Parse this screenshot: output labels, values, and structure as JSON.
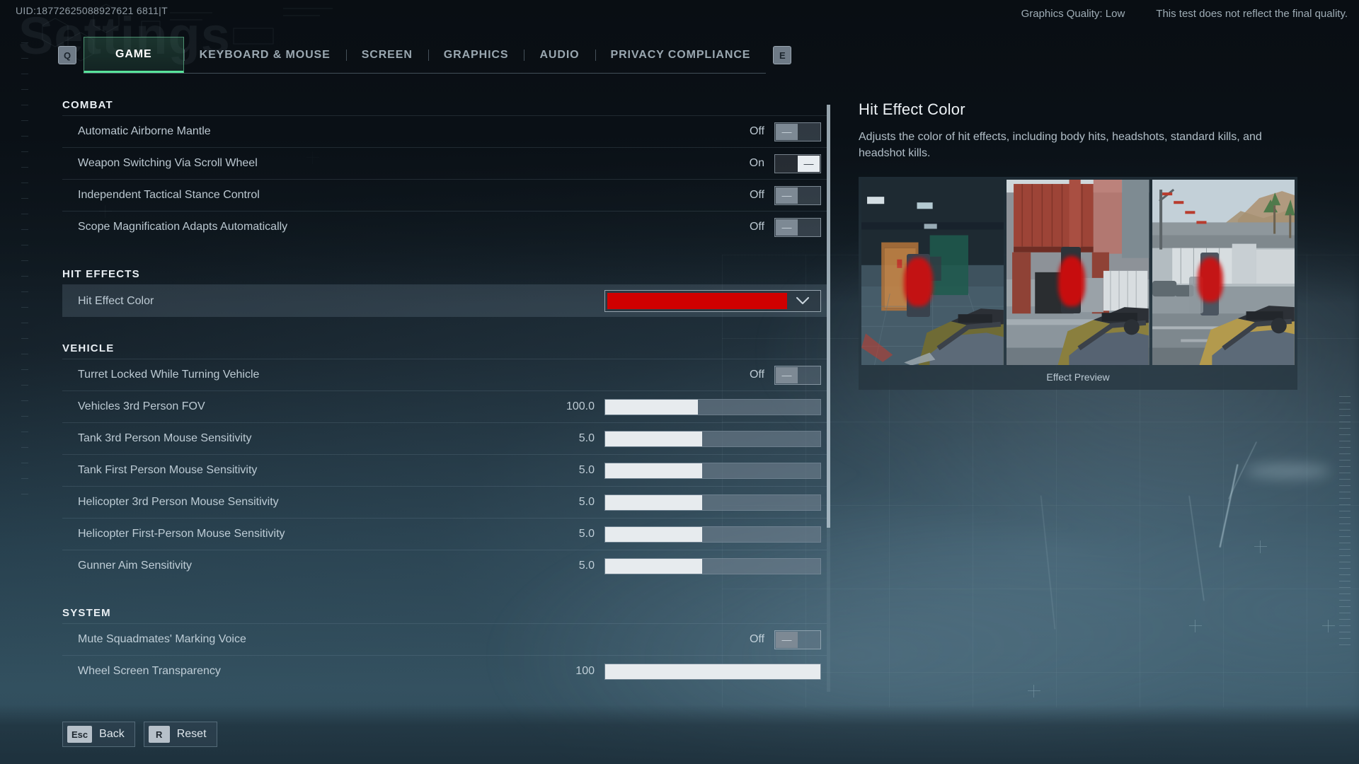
{
  "meta": {
    "uid": "UID:18772625088927621 6811|T",
    "graphics_quality": "Graphics Quality: Low",
    "disclaimer": "This test does not reflect the final quality.",
    "watermark": "Settings",
    "accent_color": "#58e39b",
    "hit_effect_color_hex": "#d00000"
  },
  "tabbar": {
    "prev_key": "Q",
    "next_key": "E",
    "tabs": [
      {
        "label": "GAME",
        "active": true
      },
      {
        "label": "KEYBOARD & MOUSE",
        "active": false
      },
      {
        "label": "SCREEN",
        "active": false
      },
      {
        "label": "GRAPHICS",
        "active": false
      },
      {
        "label": "AUDIO",
        "active": false
      },
      {
        "label": "PRIVACY COMPLIANCE",
        "active": false
      }
    ]
  },
  "sections": {
    "combat": {
      "title": "COMBAT",
      "rows": [
        {
          "label": "Automatic Airborne Mantle",
          "value": "Off",
          "type": "toggle",
          "state": "off"
        },
        {
          "label": "Weapon Switching Via Scroll Wheel",
          "value": "On",
          "type": "toggle",
          "state": "on"
        },
        {
          "label": "Independent Tactical Stance Control",
          "value": "Off",
          "type": "toggle",
          "state": "off"
        },
        {
          "label": "Scope Magnification Adapts Automatically",
          "value": "Off",
          "type": "toggle",
          "state": "off"
        }
      ]
    },
    "hit_effects": {
      "title": "HIT EFFECTS",
      "rows": [
        {
          "label": "Hit Effect Color",
          "value": "",
          "type": "color",
          "color": "#d00000",
          "selected": true
        }
      ]
    },
    "vehicle": {
      "title": "VEHICLE",
      "rows": [
        {
          "label": "Turret Locked While Turning Vehicle",
          "value": "Off",
          "type": "toggle",
          "state": "off"
        },
        {
          "label": "Vehicles 3rd Person FOV",
          "value": "100.0",
          "type": "slider",
          "fill_percent": 43
        },
        {
          "label": "Tank 3rd Person Mouse Sensitivity",
          "value": "5.0",
          "type": "slider",
          "fill_percent": 45
        },
        {
          "label": "Tank First Person Mouse Sensitivity",
          "value": "5.0",
          "type": "slider",
          "fill_percent": 45
        },
        {
          "label": "Helicopter 3rd Person Mouse Sensitivity",
          "value": "5.0",
          "type": "slider",
          "fill_percent": 45
        },
        {
          "label": "Helicopter First-Person Mouse Sensitivity",
          "value": "5.0",
          "type": "slider",
          "fill_percent": 45
        },
        {
          "label": "Gunner Aim Sensitivity",
          "value": "5.0",
          "type": "slider",
          "fill_percent": 45
        }
      ]
    },
    "system": {
      "title": "SYSTEM",
      "rows": [
        {
          "label": "Mute Squadmates' Marking Voice",
          "value": "Off",
          "type": "toggle",
          "state": "off"
        },
        {
          "label": "Wheel Screen Transparency",
          "value": "100",
          "type": "slider",
          "fill_percent": 100
        }
      ]
    }
  },
  "detail": {
    "title": "Hit Effect Color",
    "description": "Adjusts the color of hit effects, including body hits, headshots, standard kills, and headshot kills.",
    "preview_caption": "Effect Preview",
    "shots": [
      {
        "name": "indoor-warehouse-preview"
      },
      {
        "name": "shipping-container-preview"
      },
      {
        "name": "desert-town-preview"
      }
    ]
  },
  "bottombar": {
    "buttons": [
      {
        "key": "Esc",
        "label": "Back"
      },
      {
        "key": "R",
        "label": "Reset"
      }
    ]
  },
  "scrollbar": {
    "thumb_percent": 72
  }
}
